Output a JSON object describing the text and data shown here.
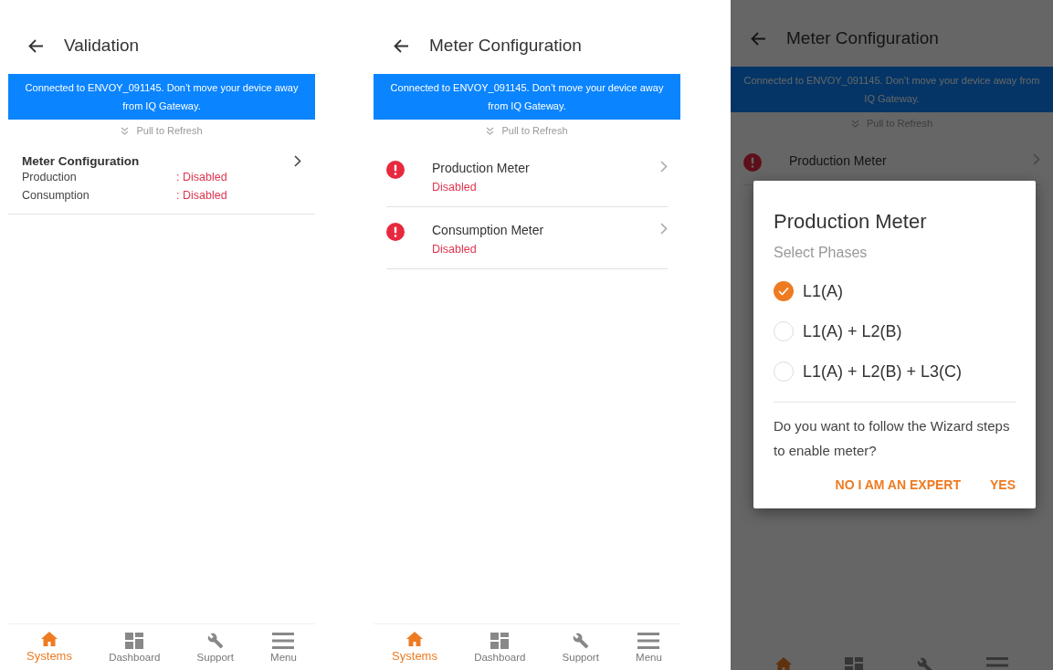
{
  "screens": [
    {
      "kind": "validation",
      "title": "Validation",
      "banner": "Connected to ENVOY_091145. Don’t move your device away from IQ Gateway.",
      "refresh": "Pull to Refresh",
      "section": {
        "title": "Meter Configuration",
        "rows": [
          {
            "label": "Production",
            "value": ": Disabled"
          },
          {
            "label": "Consumption",
            "value": ": Disabled"
          }
        ]
      },
      "nav": [
        {
          "kind": "home",
          "label": "Systems",
          "selected": true
        },
        {
          "kind": "dashboard",
          "label": "Dashboard",
          "selected": false
        },
        {
          "kind": "wrench",
          "label": "Support",
          "selected": false
        },
        {
          "kind": "menu",
          "label": "Menu",
          "selected": false
        }
      ]
    },
    {
      "kind": "meters",
      "title": "Meter Configuration",
      "banner": "Connected to ENVOY_091145. Don’t move your device away from IQ Gateway.",
      "refresh": "Pull to Refresh",
      "meters": [
        {
          "name": "Production Meter",
          "status": "Disabled"
        },
        {
          "name": "Consumption Meter",
          "status": "Disabled"
        }
      ],
      "nav": [
        {
          "kind": "home",
          "label": "Systems",
          "selected": true
        },
        {
          "kind": "dashboard",
          "label": "Dashboard",
          "selected": false
        },
        {
          "kind": "wrench",
          "label": "Support",
          "selected": false
        },
        {
          "kind": "menu",
          "label": "Menu",
          "selected": false
        }
      ]
    },
    {
      "kind": "meters",
      "title": "Meter Configuration",
      "banner": "Connected to ENVOY_091145. Don’t move your device away from IQ Gateway.",
      "refresh": "Pull to Refresh",
      "meters": [
        {
          "name": "Production Meter"
        }
      ],
      "nav": [
        {
          "kind": "home",
          "selected": true
        },
        {
          "kind": "dashboard",
          "selected": false
        },
        {
          "kind": "wrench",
          "selected": false
        },
        {
          "kind": "menu",
          "selected": false
        }
      ],
      "dialog": {
        "title": "Production Meter",
        "subtitle": "Select Phases",
        "options": [
          {
            "label": "L1(A)",
            "selected": true
          },
          {
            "label": "L1(A) + L2(B)",
            "selected": false
          },
          {
            "label": "L1(A) + L2(B) + L3(C)",
            "selected": false
          }
        ],
        "question": "Do you want to follow the Wizard steps to enable meter?",
        "buttons": [
          "NO I AM AN EXPERT",
          "YES"
        ]
      }
    }
  ]
}
